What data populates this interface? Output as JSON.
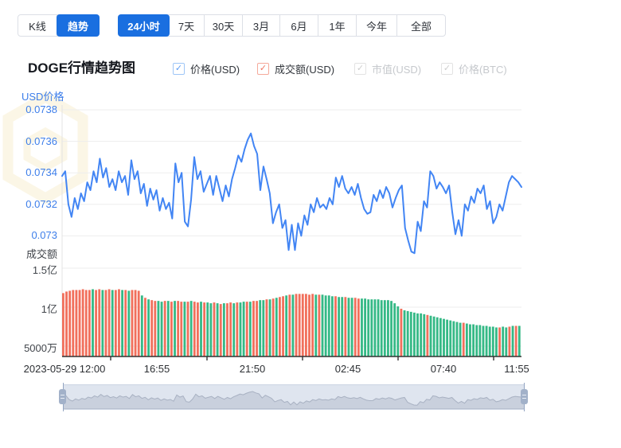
{
  "tabs": {
    "chart_type": [
      {
        "name": "tab-kline",
        "label": "K线",
        "active": false,
        "width": 49
      },
      {
        "name": "tab-trend",
        "label": "趋势",
        "active": true,
        "width": 54
      }
    ],
    "range": [
      {
        "name": "tab-24h",
        "label": "24小时",
        "active": true,
        "width": 65
      },
      {
        "name": "tab-7d",
        "label": "7天",
        "active": false,
        "width": 45
      },
      {
        "name": "tab-30d",
        "label": "30天",
        "active": false,
        "width": 48
      },
      {
        "name": "tab-3m",
        "label": "3月",
        "active": false,
        "width": 47
      },
      {
        "name": "tab-6m",
        "label": "6月",
        "active": false,
        "width": 48
      },
      {
        "name": "tab-1y",
        "label": "1年",
        "active": false,
        "width": 48
      },
      {
        "name": "tab-ytd",
        "label": "今年",
        "active": false,
        "width": 51
      },
      {
        "name": "tab-all",
        "label": "全部",
        "active": false,
        "width": 60
      }
    ]
  },
  "header": {
    "title": "DOGE行情趋势图"
  },
  "legend": [
    {
      "name": "legend-price-usd",
      "label": "价格(USD)",
      "checked": true,
      "enabled": true,
      "box_border": "#9ec6f7",
      "check_color": "#5b9cf5",
      "left": 217
    },
    {
      "name": "legend-volume-usd",
      "label": "成交额(USD)",
      "checked": true,
      "enabled": true,
      "box_border": "#f5a99a",
      "check_color": "#ee7560",
      "left": 323
    },
    {
      "name": "legend-marketcap-usd",
      "label": "市值(USD)",
      "checked": true,
      "enabled": false,
      "box_border": "#e3e3e3",
      "check_color": "#cdcdcd",
      "left": 445
    },
    {
      "name": "legend-price-btc",
      "label": "价格(BTC)",
      "checked": true,
      "enabled": false,
      "box_border": "#e3e3e3",
      "check_color": "#cdcdcd",
      "left": 554
    }
  ],
  "colors": {
    "accent_blue": "#1a6fe0",
    "line_blue": "#4285f4",
    "bar_red": "#f1705c",
    "bar_green": "#35b986",
    "axis_blue": "#3d7eea",
    "grid": "#ededed",
    "axis_line": "#333333",
    "watermark": "#f8f0d3",
    "nav_area": "#c9d0dd",
    "nav_line": "#a8b1c2"
  },
  "chart_data": {
    "type": "line+bar",
    "title": "DOGE行情趋势图",
    "price_axis": {
      "label": "USD价格",
      "ticks": [
        "0.0738",
        "0.0736",
        "0.0734",
        "0.0732",
        "0.073"
      ],
      "tick_values": [
        0.0738,
        0.0736,
        0.0734,
        0.0732,
        0.073
      ]
    },
    "volume_axis": {
      "label": "成交额",
      "ticks": [
        "1.5亿",
        "1亿",
        "5000万"
      ],
      "tick_values_yi": [
        1.5,
        1.0,
        0.5
      ]
    },
    "x_ticks": [
      "2023-05-29 12:00",
      "16:55",
      "21:50",
      "02:45",
      "07:40",
      "11:55"
    ],
    "grid": true,
    "legend_position": "top",
    "series": [
      {
        "name": "价格(USD)",
        "type": "line",
        "color": "#4285f4",
        "unit": "USD",
        "values": [
          0.07338,
          0.07341,
          0.0732,
          0.07312,
          0.07324,
          0.07317,
          0.07327,
          0.07322,
          0.07334,
          0.07329,
          0.07341,
          0.07334,
          0.07349,
          0.07337,
          0.07343,
          0.07331,
          0.07336,
          0.07329,
          0.07341,
          0.07334,
          0.07338,
          0.07326,
          0.07348,
          0.07336,
          0.07341,
          0.07327,
          0.07333,
          0.07319,
          0.0733,
          0.07323,
          0.07329,
          0.07316,
          0.07324,
          0.07317,
          0.07321,
          0.07311,
          0.07346,
          0.07334,
          0.0734,
          0.07309,
          0.07306,
          0.07323,
          0.0735,
          0.07336,
          0.07341,
          0.07328,
          0.07333,
          0.07338,
          0.07326,
          0.07338,
          0.0733,
          0.07322,
          0.07332,
          0.07325,
          0.07336,
          0.07343,
          0.07351,
          0.07347,
          0.07355,
          0.07361,
          0.07365,
          0.07357,
          0.07352,
          0.07329,
          0.07344,
          0.07336,
          0.07327,
          0.07308,
          0.07315,
          0.0732,
          0.07305,
          0.0731,
          0.07291,
          0.07307,
          0.07291,
          0.07308,
          0.073,
          0.07313,
          0.07307,
          0.0732,
          0.07315,
          0.07324,
          0.07318,
          0.0732,
          0.07317,
          0.07324,
          0.0732,
          0.07337,
          0.07331,
          0.07338,
          0.0733,
          0.07327,
          0.07331,
          0.07326,
          0.07333,
          0.07324,
          0.07317,
          0.07314,
          0.07315,
          0.07326,
          0.07322,
          0.07329,
          0.07324,
          0.07331,
          0.07327,
          0.07318,
          0.07324,
          0.07329,
          0.07332,
          0.07305,
          0.07297,
          0.0729,
          0.07289,
          0.07309,
          0.07303,
          0.07322,
          0.07318,
          0.07341,
          0.07338,
          0.0733,
          0.07334,
          0.07331,
          0.07327,
          0.07332,
          0.07315,
          0.07301,
          0.0731,
          0.073,
          0.0732,
          0.07316,
          0.07325,
          0.07321,
          0.0733,
          0.07327,
          0.07332,
          0.07317,
          0.07322,
          0.07308,
          0.07312,
          0.0732,
          0.07316,
          0.07325,
          0.07334,
          0.07338,
          0.07336,
          0.07334,
          0.07331
        ]
      },
      {
        "name": "成交额(USD)",
        "type": "bar",
        "unit": "亿",
        "up_color": "#35b986",
        "down_color": "#f1705c",
        "values": [
          1.18,
          1.2,
          1.21,
          1.22,
          1.22,
          1.22,
          1.23,
          1.22,
          1.22,
          1.23,
          1.22,
          1.23,
          1.22,
          1.22,
          1.23,
          1.22,
          1.22,
          1.23,
          1.22,
          1.22,
          1.21,
          1.22,
          1.22,
          1.21,
          1.15,
          1.12,
          1.1,
          1.09,
          1.08,
          1.08,
          1.07,
          1.08,
          1.08,
          1.07,
          1.08,
          1.08,
          1.07,
          1.07,
          1.07,
          1.08,
          1.07,
          1.06,
          1.07,
          1.06,
          1.06,
          1.05,
          1.06,
          1.05,
          1.04,
          1.05,
          1.05,
          1.06,
          1.05,
          1.06,
          1.06,
          1.07,
          1.07,
          1.07,
          1.08,
          1.08,
          1.09,
          1.09,
          1.1,
          1.1,
          1.11,
          1.12,
          1.13,
          1.14,
          1.15,
          1.16,
          1.16,
          1.17,
          1.17,
          1.17,
          1.17,
          1.16,
          1.17,
          1.16,
          1.16,
          1.16,
          1.15,
          1.15,
          1.14,
          1.14,
          1.13,
          1.13,
          1.13,
          1.12,
          1.12,
          1.12,
          1.11,
          1.11,
          1.11,
          1.1,
          1.1,
          1.1,
          1.1,
          1.09,
          1.09,
          1.09,
          1.08,
          1.05,
          1.01,
          0.98,
          0.96,
          0.95,
          0.94,
          0.93,
          0.92,
          0.92,
          0.91,
          0.9,
          0.89,
          0.88,
          0.87,
          0.86,
          0.85,
          0.84,
          0.83,
          0.82,
          0.81,
          0.8,
          0.8,
          0.79,
          0.78,
          0.78,
          0.77,
          0.77,
          0.76,
          0.76,
          0.75,
          0.75,
          0.74,
          0.74,
          0.75,
          0.74,
          0.75,
          0.76,
          0.76,
          0.76
        ],
        "bar_colors": "rrrrrrrrrgrrgrrgrrgrgrrrgrgrrggrgrgrrgrgrrgrggrgrgrrgrggrgrrggrgrgrrgrgrrrrrrgrggggrggrggrrggggggggggggrgggggggrggggggggggrggggggggggrggrgrgrg"
      }
    ]
  }
}
